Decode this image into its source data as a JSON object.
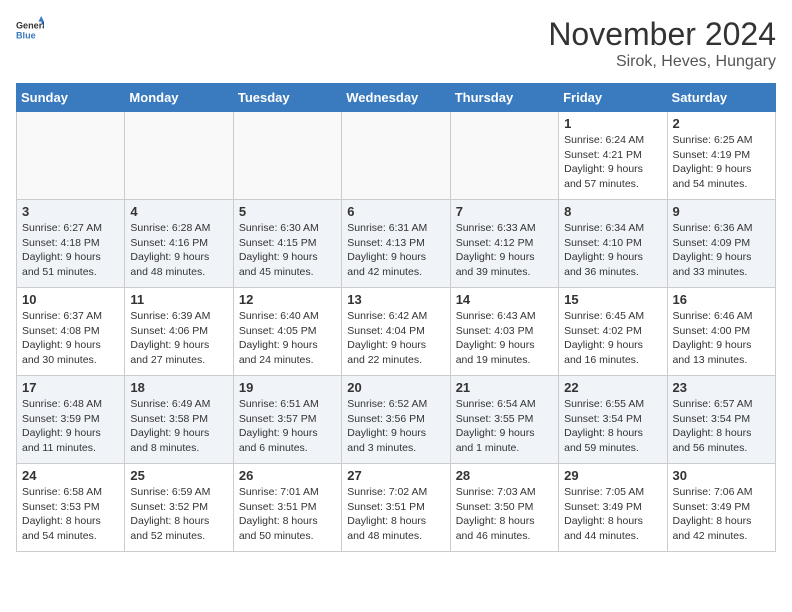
{
  "logo": {
    "general": "General",
    "blue": "Blue"
  },
  "title": "November 2024",
  "location": "Sirok, Heves, Hungary",
  "headers": [
    "Sunday",
    "Monday",
    "Tuesday",
    "Wednesday",
    "Thursday",
    "Friday",
    "Saturday"
  ],
  "weeks": [
    [
      {
        "day": "",
        "info": ""
      },
      {
        "day": "",
        "info": ""
      },
      {
        "day": "",
        "info": ""
      },
      {
        "day": "",
        "info": ""
      },
      {
        "day": "",
        "info": ""
      },
      {
        "day": "1",
        "info": "Sunrise: 6:24 AM\nSunset: 4:21 PM\nDaylight: 9 hours\nand 57 minutes."
      },
      {
        "day": "2",
        "info": "Sunrise: 6:25 AM\nSunset: 4:19 PM\nDaylight: 9 hours\nand 54 minutes."
      }
    ],
    [
      {
        "day": "3",
        "info": "Sunrise: 6:27 AM\nSunset: 4:18 PM\nDaylight: 9 hours\nand 51 minutes."
      },
      {
        "day": "4",
        "info": "Sunrise: 6:28 AM\nSunset: 4:16 PM\nDaylight: 9 hours\nand 48 minutes."
      },
      {
        "day": "5",
        "info": "Sunrise: 6:30 AM\nSunset: 4:15 PM\nDaylight: 9 hours\nand 45 minutes."
      },
      {
        "day": "6",
        "info": "Sunrise: 6:31 AM\nSunset: 4:13 PM\nDaylight: 9 hours\nand 42 minutes."
      },
      {
        "day": "7",
        "info": "Sunrise: 6:33 AM\nSunset: 4:12 PM\nDaylight: 9 hours\nand 39 minutes."
      },
      {
        "day": "8",
        "info": "Sunrise: 6:34 AM\nSunset: 4:10 PM\nDaylight: 9 hours\nand 36 minutes."
      },
      {
        "day": "9",
        "info": "Sunrise: 6:36 AM\nSunset: 4:09 PM\nDaylight: 9 hours\nand 33 minutes."
      }
    ],
    [
      {
        "day": "10",
        "info": "Sunrise: 6:37 AM\nSunset: 4:08 PM\nDaylight: 9 hours\nand 30 minutes."
      },
      {
        "day": "11",
        "info": "Sunrise: 6:39 AM\nSunset: 4:06 PM\nDaylight: 9 hours\nand 27 minutes."
      },
      {
        "day": "12",
        "info": "Sunrise: 6:40 AM\nSunset: 4:05 PM\nDaylight: 9 hours\nand 24 minutes."
      },
      {
        "day": "13",
        "info": "Sunrise: 6:42 AM\nSunset: 4:04 PM\nDaylight: 9 hours\nand 22 minutes."
      },
      {
        "day": "14",
        "info": "Sunrise: 6:43 AM\nSunset: 4:03 PM\nDaylight: 9 hours\nand 19 minutes."
      },
      {
        "day": "15",
        "info": "Sunrise: 6:45 AM\nSunset: 4:02 PM\nDaylight: 9 hours\nand 16 minutes."
      },
      {
        "day": "16",
        "info": "Sunrise: 6:46 AM\nSunset: 4:00 PM\nDaylight: 9 hours\nand 13 minutes."
      }
    ],
    [
      {
        "day": "17",
        "info": "Sunrise: 6:48 AM\nSunset: 3:59 PM\nDaylight: 9 hours\nand 11 minutes."
      },
      {
        "day": "18",
        "info": "Sunrise: 6:49 AM\nSunset: 3:58 PM\nDaylight: 9 hours\nand 8 minutes."
      },
      {
        "day": "19",
        "info": "Sunrise: 6:51 AM\nSunset: 3:57 PM\nDaylight: 9 hours\nand 6 minutes."
      },
      {
        "day": "20",
        "info": "Sunrise: 6:52 AM\nSunset: 3:56 PM\nDaylight: 9 hours\nand 3 minutes."
      },
      {
        "day": "21",
        "info": "Sunrise: 6:54 AM\nSunset: 3:55 PM\nDaylight: 9 hours\nand 1 minute."
      },
      {
        "day": "22",
        "info": "Sunrise: 6:55 AM\nSunset: 3:54 PM\nDaylight: 8 hours\nand 59 minutes."
      },
      {
        "day": "23",
        "info": "Sunrise: 6:57 AM\nSunset: 3:54 PM\nDaylight: 8 hours\nand 56 minutes."
      }
    ],
    [
      {
        "day": "24",
        "info": "Sunrise: 6:58 AM\nSunset: 3:53 PM\nDaylight: 8 hours\nand 54 minutes."
      },
      {
        "day": "25",
        "info": "Sunrise: 6:59 AM\nSunset: 3:52 PM\nDaylight: 8 hours\nand 52 minutes."
      },
      {
        "day": "26",
        "info": "Sunrise: 7:01 AM\nSunset: 3:51 PM\nDaylight: 8 hours\nand 50 minutes."
      },
      {
        "day": "27",
        "info": "Sunrise: 7:02 AM\nSunset: 3:51 PM\nDaylight: 8 hours\nand 48 minutes."
      },
      {
        "day": "28",
        "info": "Sunrise: 7:03 AM\nSunset: 3:50 PM\nDaylight: 8 hours\nand 46 minutes."
      },
      {
        "day": "29",
        "info": "Sunrise: 7:05 AM\nSunset: 3:49 PM\nDaylight: 8 hours\nand 44 minutes."
      },
      {
        "day": "30",
        "info": "Sunrise: 7:06 AM\nSunset: 3:49 PM\nDaylight: 8 hours\nand 42 minutes."
      }
    ]
  ]
}
